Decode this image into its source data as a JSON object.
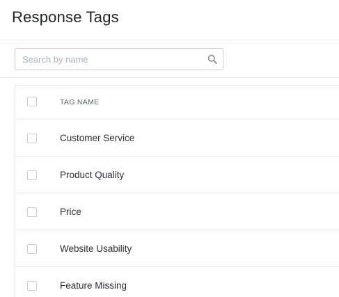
{
  "header": {
    "title": "Response Tags"
  },
  "search": {
    "placeholder": "Search by name",
    "value": ""
  },
  "table": {
    "columns": [
      "TAG NAME"
    ],
    "rows": [
      {
        "name": "Customer Service"
      },
      {
        "name": "Product Quality"
      },
      {
        "name": "Price"
      },
      {
        "name": "Website Usability"
      },
      {
        "name": "Feature Missing"
      }
    ]
  },
  "icons": {
    "search": "search-icon"
  }
}
